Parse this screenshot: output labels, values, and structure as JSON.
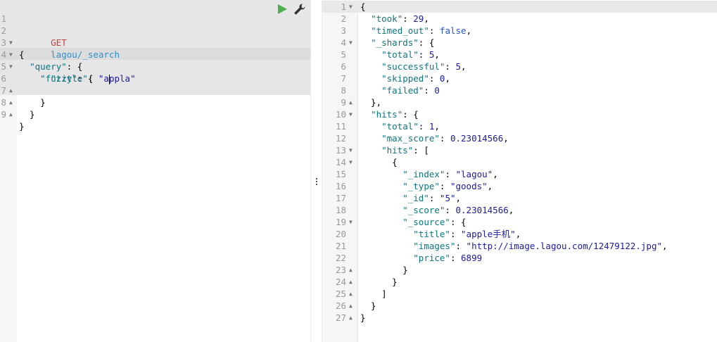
{
  "request": {
    "method": "GET",
    "path": "lagou/_search",
    "lines": [
      {
        "num": "1"
      },
      {
        "num": "2",
        "text": "{"
      },
      {
        "num": "3",
        "pre": "  ",
        "key": "\"query\"",
        "post": ": {"
      },
      {
        "num": "4",
        "pre": "    ",
        "key": "\"fuzzy\"",
        "post": ": {"
      },
      {
        "num": "5",
        "pre": "      ",
        "key": "\"title\"",
        "post": ": ",
        "str_a": "\"a",
        "str_b": "ppla\""
      },
      {
        "num": "6",
        "text": "    }"
      },
      {
        "num": "7",
        "text": "  }"
      },
      {
        "num": "8",
        "text": "}"
      },
      {
        "num": "9",
        "text": ""
      }
    ]
  },
  "response": {
    "lines": [
      {
        "num": "1",
        "text": "{"
      },
      {
        "num": "2",
        "pre": "  ",
        "key": "\"took\"",
        "post": ": ",
        "val": "29",
        "vtype": "n",
        "tail": ","
      },
      {
        "num": "3",
        "pre": "  ",
        "key": "\"timed_out\"",
        "post": ": ",
        "val": "false",
        "vtype": "b",
        "tail": ","
      },
      {
        "num": "4",
        "pre": "  ",
        "key": "\"_shards\"",
        "post": ": {"
      },
      {
        "num": "5",
        "pre": "    ",
        "key": "\"total\"",
        "post": ": ",
        "val": "5",
        "vtype": "n",
        "tail": ","
      },
      {
        "num": "6",
        "pre": "    ",
        "key": "\"successful\"",
        "post": ": ",
        "val": "5",
        "vtype": "n",
        "tail": ","
      },
      {
        "num": "7",
        "pre": "    ",
        "key": "\"skipped\"",
        "post": ": ",
        "val": "0",
        "vtype": "n",
        "tail": ","
      },
      {
        "num": "8",
        "pre": "    ",
        "key": "\"failed\"",
        "post": ": ",
        "val": "0",
        "vtype": "n",
        "tail": ""
      },
      {
        "num": "9",
        "text": "  },"
      },
      {
        "num": "10",
        "pre": "  ",
        "key": "\"hits\"",
        "post": ": {"
      },
      {
        "num": "11",
        "pre": "    ",
        "key": "\"total\"",
        "post": ": ",
        "val": "1",
        "vtype": "n",
        "tail": ","
      },
      {
        "num": "12",
        "pre": "    ",
        "key": "\"max_score\"",
        "post": ": ",
        "val": "0.23014566",
        "vtype": "n",
        "tail": ","
      },
      {
        "num": "13",
        "pre": "    ",
        "key": "\"hits\"",
        "post": ": ["
      },
      {
        "num": "14",
        "text": "      {"
      },
      {
        "num": "15",
        "pre": "        ",
        "key": "\"_index\"",
        "post": ": ",
        "val": "\"lagou\"",
        "vtype": "s",
        "tail": ","
      },
      {
        "num": "16",
        "pre": "        ",
        "key": "\"_type\"",
        "post": ": ",
        "val": "\"goods\"",
        "vtype": "s",
        "tail": ","
      },
      {
        "num": "17",
        "pre": "        ",
        "key": "\"_id\"",
        "post": ": ",
        "val": "\"5\"",
        "vtype": "s",
        "tail": ","
      },
      {
        "num": "18",
        "pre": "        ",
        "key": "\"_score\"",
        "post": ": ",
        "val": "0.23014566",
        "vtype": "n",
        "tail": ","
      },
      {
        "num": "19",
        "pre": "        ",
        "key": "\"_source\"",
        "post": ": {"
      },
      {
        "num": "20",
        "pre": "          ",
        "key": "\"title\"",
        "post": ": ",
        "val": "\"apple手机\"",
        "vtype": "s",
        "tail": ","
      },
      {
        "num": "21",
        "pre": "          ",
        "key": "\"images\"",
        "post": ": ",
        "val": "\"http://image.lagou.com/12479122.jpg\"",
        "vtype": "s",
        "tail": ","
      },
      {
        "num": "22",
        "pre": "          ",
        "key": "\"price\"",
        "post": ": ",
        "val": "6899",
        "vtype": "n",
        "tail": ""
      },
      {
        "num": "23",
        "text": "        }"
      },
      {
        "num": "24",
        "text": "      }"
      },
      {
        "num": "25",
        "text": "    ]"
      },
      {
        "num": "26",
        "text": "  }"
      },
      {
        "num": "27",
        "text": "}"
      }
    ]
  },
  "colors": {
    "send_green": "#4caf50",
    "key": "#0b7680",
    "string": "#1a1aa6",
    "method": "#c73e3e",
    "url": "#2f8fc7"
  },
  "icons": {
    "send": "play-icon",
    "settings": "wrench-icon",
    "splitter": "vertical-dots-icon"
  }
}
